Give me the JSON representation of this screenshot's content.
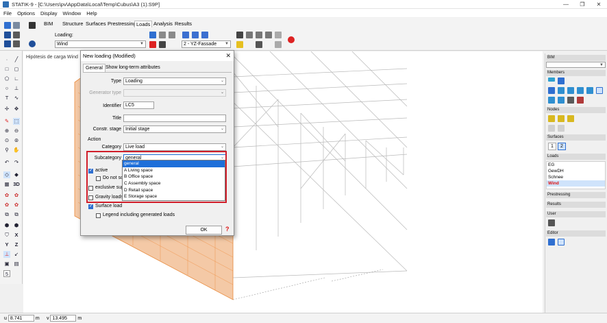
{
  "app": {
    "title": "STATIK-9 - [C:\\Users\\pv\\AppData\\Local\\Temp\\Cubus\\A3 (1).S9P]",
    "menu": [
      "File",
      "Options",
      "Display",
      "Window",
      "Help"
    ]
  },
  "ribbon": {
    "tabs": [
      "BIM",
      "Structure",
      "Surfaces",
      "Prestressing",
      "Loads",
      "Analysis",
      "Results"
    ],
    "active_tab": "Loads",
    "loading_label": "Loading:",
    "loading_value": "Wind",
    "view_value": "2 - YZ-Fassade"
  },
  "canvas": {
    "hint": "Hipótesis de carga Wind"
  },
  "dialog": {
    "title": "New loading (Modified)",
    "tabs": [
      "General",
      "Show long-term attributes"
    ],
    "type_label": "Type",
    "type_value": "Loading",
    "generator_label": "Generator type",
    "identifier_label": "Identifier",
    "identifier_value": "LC5",
    "title_label": "Title",
    "title_value": "",
    "stage_label": "Constr. stage",
    "stage_value": "Initial stage",
    "action_label": "Action",
    "category_label": "Category",
    "category_value": "Live load",
    "subcategory_label": "Subcategory",
    "subcategory_value": "general",
    "subcategory_options": [
      "general",
      "A Living space",
      "B Office space",
      "C Assembly space",
      "D Retail space",
      "E Storage space"
    ],
    "active_label": "active",
    "do_not_label": "Do not so",
    "exclusive_label": "exclusive sup",
    "gravity_label": "Gravity loads",
    "surface_load_label": "Surface load",
    "legend_label": "Legend including generated loads",
    "ok_label": "OK",
    "help_label": "?"
  },
  "right_panel": {
    "bim": "BIM",
    "members": "Members",
    "nodes": "Nodes",
    "surfaces": "Surfaces",
    "surface_tabs": [
      "1",
      "2"
    ],
    "loads": "Loads",
    "load_items": [
      "EG",
      "GewDH",
      "Schnee",
      "Wind"
    ],
    "selected_load": "Wind",
    "prestressing": "Prestressing",
    "results": "Results",
    "user": "User",
    "editor": "Editor"
  },
  "status": {
    "u_label": "u",
    "u_value": "8.741",
    "u_unit": "m",
    "v_label": "v",
    "v_value": "13.495",
    "v_unit": "m"
  }
}
